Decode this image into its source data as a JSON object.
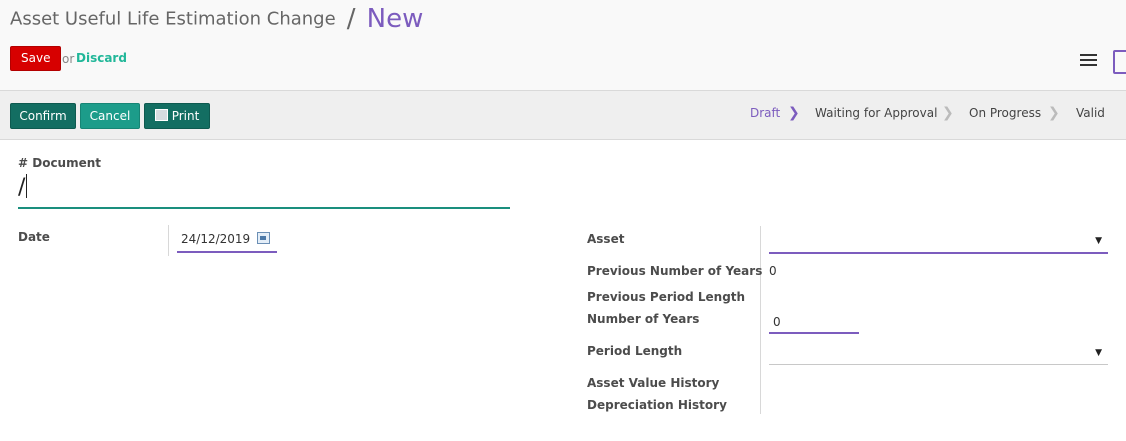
{
  "breadcrumb": {
    "parent": "Asset Useful Life Estimation Change",
    "separator": "/",
    "current": "New"
  },
  "actions": {
    "save": "Save",
    "or": "or",
    "discard": "Discard"
  },
  "statusbar": {
    "confirm": "Confirm",
    "cancel": "Cancel",
    "print": "Print",
    "stages": [
      "Draft",
      "Waiting for Approval",
      "On Progress",
      "Valid"
    ],
    "active_stage": "Draft"
  },
  "form": {
    "document_label": "# Document",
    "document_value": "/",
    "date_label": "Date",
    "date_value": "24/12/2019",
    "asset_label": "Asset",
    "asset_value": "",
    "prev_years_label": "Previous Number of Years",
    "prev_years_value": "0",
    "prev_period_label": "Previous Period Length",
    "num_years_label": "Number of Years",
    "num_years_value": "0",
    "period_length_label": "Period Length",
    "period_length_value": "",
    "asset_value_history_label": "Asset Value History",
    "depreciation_history_label": "Depreciation History"
  },
  "icons": {
    "menu": "hamburger-menu-icon",
    "view": "form-view-icon",
    "calendar": "calendar-icon",
    "printer": "printer-icon"
  },
  "colors": {
    "accent": "#7c5cbe",
    "save": "#d70000",
    "primary": "#136e62",
    "teal": "#1c9c8a"
  }
}
